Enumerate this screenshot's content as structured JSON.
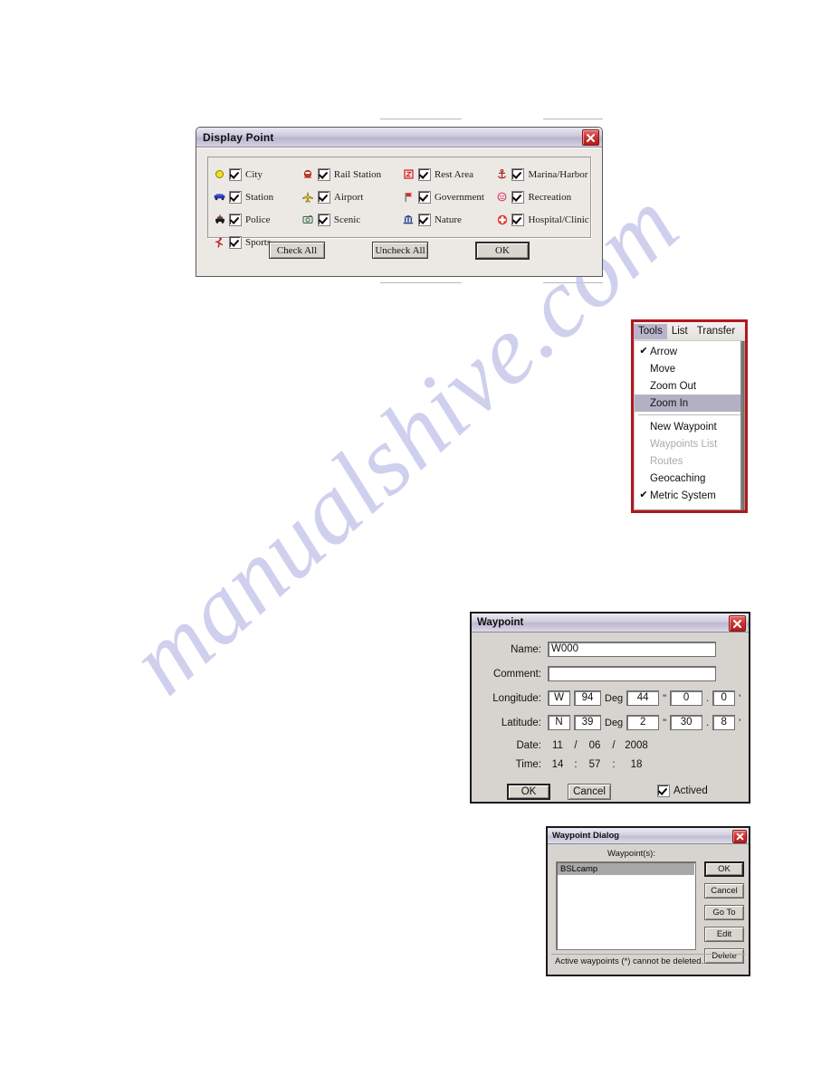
{
  "watermark": {
    "text": "manualshive.com"
  },
  "display_point": {
    "title": "Display Point",
    "close_icon": "close-icon",
    "rows": [
      [
        {
          "icon": "city-icon",
          "label": "City",
          "checked": true
        },
        {
          "icon": "rail-station-icon",
          "label": "Rail Station",
          "checked": true
        },
        {
          "icon": "rest-area-icon",
          "label": "Rest Area",
          "checked": true
        },
        {
          "icon": "marina-harbor-icon",
          "label": "Marina/Harbor",
          "checked": true
        }
      ],
      [
        {
          "icon": "station-icon",
          "label": "Station",
          "checked": true
        },
        {
          "icon": "airport-icon",
          "label": "Airport",
          "checked": true
        },
        {
          "icon": "government-icon",
          "label": "Government",
          "checked": true
        },
        {
          "icon": "recreation-icon",
          "label": "Recreation",
          "checked": true
        }
      ],
      [
        {
          "icon": "police-icon",
          "label": "Police",
          "checked": true
        },
        {
          "icon": "scenic-icon",
          "label": "Scenic",
          "checked": true
        },
        {
          "icon": "nature-icon",
          "label": "Nature",
          "checked": true
        },
        {
          "icon": "hospital-clinic-icon",
          "label": "Hospital/Clinic",
          "checked": true
        }
      ],
      [
        {
          "icon": "sports-icon",
          "label": "Sports",
          "checked": true
        }
      ]
    ],
    "buttons": {
      "check_all": "Check All",
      "uncheck_all": "Uncheck All",
      "ok": "OK"
    }
  },
  "tools_menu": {
    "menubar": [
      {
        "label": "Tools",
        "active": true
      },
      {
        "label": "List",
        "active": false
      },
      {
        "label": "Transfer",
        "active": false
      }
    ],
    "items": [
      {
        "label": "Arrow",
        "checked": true,
        "disabled": false,
        "selected": false
      },
      {
        "label": "Move",
        "checked": false,
        "disabled": false,
        "selected": false
      },
      {
        "label": "Zoom Out",
        "checked": false,
        "disabled": false,
        "selected": false
      },
      {
        "label": "Zoom In",
        "checked": false,
        "disabled": false,
        "selected": true
      },
      {
        "separator": true
      },
      {
        "label": "New Waypoint",
        "checked": false,
        "disabled": false,
        "selected": false
      },
      {
        "label": "Waypoints List",
        "checked": false,
        "disabled": true,
        "selected": false
      },
      {
        "label": "Routes",
        "checked": false,
        "disabled": true,
        "selected": false
      },
      {
        "label": "Geocaching",
        "checked": false,
        "disabled": false,
        "selected": false
      },
      {
        "label": "Metric System",
        "checked": true,
        "disabled": false,
        "selected": false
      }
    ],
    "check_glyph": "✔"
  },
  "waypoint": {
    "title": "Waypoint",
    "labels": {
      "name": "Name:",
      "comment": "Comment:",
      "longitude": "Longitude:",
      "latitude": "Latitude:",
      "date": "Date:",
      "time": "Time:"
    },
    "name_value": "W000",
    "comment_value": "",
    "longitude": {
      "hemisphere": "W",
      "deg": "94",
      "deg_unit": "Deg",
      "min": "44",
      "min_unit": "\"",
      "sec": "0",
      "dot": ".",
      "frac": "0",
      "sec_unit": "'"
    },
    "latitude": {
      "hemisphere": "N",
      "deg": "39",
      "deg_unit": "Deg",
      "min": "2",
      "min_unit": "\"",
      "sec": "30",
      "dot": ".",
      "frac": "8",
      "sec_unit": "'"
    },
    "date": {
      "month": "11",
      "sep1": "/",
      "day": "06",
      "sep2": "/",
      "year": "2008"
    },
    "time": {
      "hour": "14",
      "sep1": ":",
      "minute": "57",
      "sep2": ":",
      "second": "18"
    },
    "buttons": {
      "ok": "OK",
      "cancel": "Cancel"
    },
    "actived": {
      "label": "Actived",
      "checked": true
    }
  },
  "waypoint_dialog": {
    "title": "Waypoint Dialog",
    "list_label": "Waypoint(s):",
    "items": [
      {
        "label": "BSLcamp",
        "selected": true
      }
    ],
    "buttons": [
      {
        "label": "OK",
        "primary": true
      },
      {
        "label": "Cancel",
        "primary": false
      },
      {
        "label": "Go To",
        "primary": false
      },
      {
        "label": "Edit",
        "primary": false
      },
      {
        "label": "Delete",
        "primary": false
      }
    ],
    "footer": "Active waypoints (*) cannot be deleted."
  },
  "colors": {
    "dialog_face": "#d7d4cf",
    "titlebar_purple": "#bdb8d0",
    "close_red": "#cf3535",
    "menu_border_red": "#b01820",
    "menu_highlight": "#b4b0c4",
    "watermark_blue": "#c6c8ea"
  }
}
